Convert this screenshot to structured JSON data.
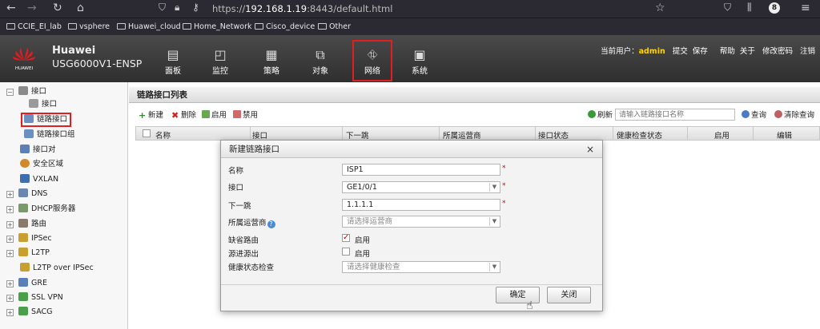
{
  "browser": {
    "url_prefix": "https://",
    "url_host": "192.168.1.19",
    "url_rest": ":8443/default.html",
    "bookmarks": [
      "CCIE_EI_lab",
      "vsphere",
      "Huawei_cloud",
      "Home_Network",
      "Cisco_device",
      "Other"
    ]
  },
  "header": {
    "brand": "Huawei",
    "model": "USG6000V1-ENSP",
    "logo_text": "HUAWEI",
    "nav": [
      {
        "label": "面板",
        "icon": "dashboard-icon"
      },
      {
        "label": "监控",
        "icon": "monitor-icon"
      },
      {
        "label": "策略",
        "icon": "policy-icon"
      },
      {
        "label": "对象",
        "icon": "object-icon"
      },
      {
        "label": "网络",
        "icon": "network-icon"
      },
      {
        "label": "系统",
        "icon": "system-icon"
      }
    ],
    "active_nav": "网络",
    "user_prefix": "当前用户：",
    "user_name": "admin",
    "links": [
      "提交",
      "保存",
      "帮助",
      "关于",
      "修改密码",
      "注销"
    ]
  },
  "sidebar": {
    "items": [
      {
        "label": "接口",
        "toggle": "−"
      },
      {
        "label": "接口"
      },
      {
        "label": "链路接口"
      },
      {
        "label": "链路接口组"
      },
      {
        "label": "接口对"
      },
      {
        "label": "安全区域"
      },
      {
        "label": "VXLAN"
      },
      {
        "label": "DNS",
        "toggle": "+"
      },
      {
        "label": "DHCP服务器",
        "toggle": "+"
      },
      {
        "label": "路由",
        "toggle": "+"
      },
      {
        "label": "IPSec",
        "toggle": "+"
      },
      {
        "label": "L2TP",
        "toggle": "+"
      },
      {
        "label": "L2TP over IPSec"
      },
      {
        "label": "GRE",
        "toggle": "+"
      },
      {
        "label": "SSL VPN",
        "toggle": "+"
      },
      {
        "label": "SACG",
        "toggle": "+"
      }
    ]
  },
  "main": {
    "title": "链路接口列表",
    "toolbar": {
      "new": "新建",
      "delete": "删除",
      "enable": "启用",
      "disable": "禁用",
      "refresh": "刷新",
      "query": "查询",
      "clear_query": "清除查询"
    },
    "search_placeholder": "请输入链路接口名称",
    "columns": [
      "名称",
      "接口",
      "下一跳",
      "所属运营商",
      "接口状态",
      "健康检查状态",
      "启用",
      "编辑"
    ]
  },
  "dialog": {
    "title": "新建链路接口",
    "close": "×",
    "fields": {
      "name_label": "名称",
      "name_value": "ISP1",
      "interface_label": "接口",
      "interface_value": "GE1/0/1",
      "nexthop_label": "下一跳",
      "nexthop_value": "1.1.1.1",
      "isp_label": "所属运营商",
      "isp_placeholder": "请选择运营商",
      "default_route_label": "缺省路由",
      "default_route_checked": true,
      "default_route_option": "启用",
      "source_label": "源进源出",
      "source_checked": false,
      "source_option": "启用",
      "health_label": "健康状态检查",
      "health_placeholder": "请选择健康检查"
    },
    "required_mark": "*",
    "ok": "确定",
    "close_button": "关闭"
  }
}
